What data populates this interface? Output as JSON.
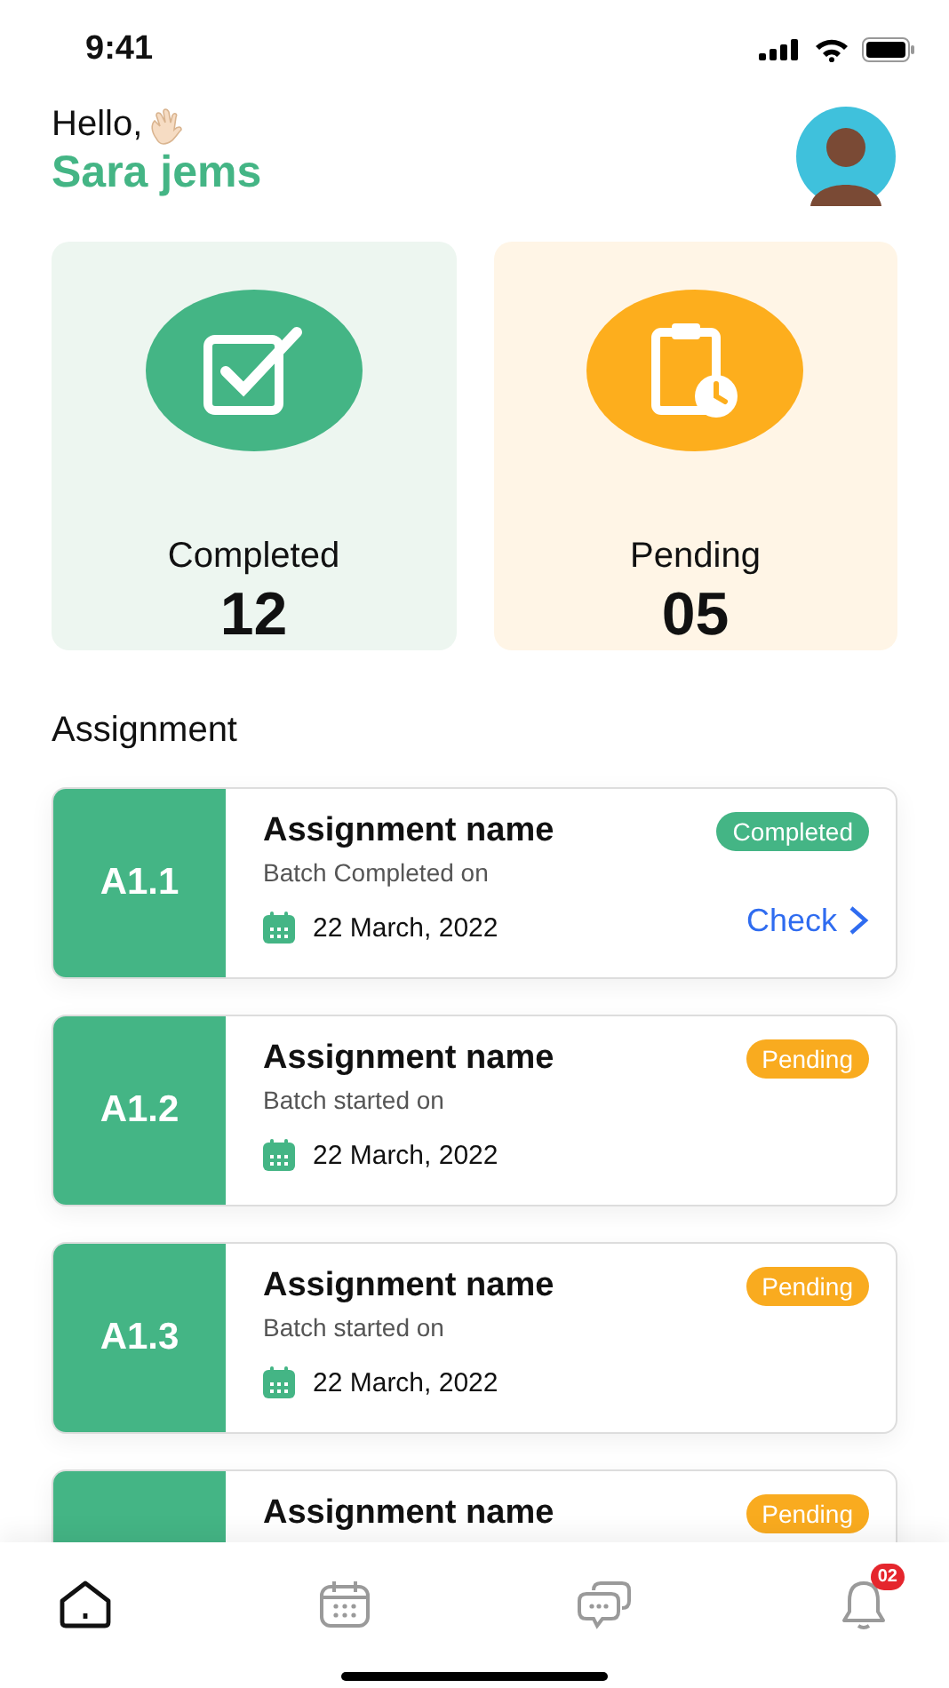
{
  "status_bar": {
    "time": "9:41"
  },
  "header": {
    "greeting": "Hello,",
    "name": "Sara jems"
  },
  "stats": [
    {
      "kind": "completed",
      "label": "Completed",
      "count": "12"
    },
    {
      "kind": "pending",
      "label": "Pending",
      "count": "05"
    }
  ],
  "section_title": "Assignment",
  "assignments": [
    {
      "code": "A1.1",
      "title": "Assignment name",
      "status": "Completed",
      "color": "#44b585",
      "subtitle": "Batch Completed on",
      "date": "22 March, 2022",
      "action": "Check"
    },
    {
      "code": "A1.2",
      "title": "Assignment name",
      "status": "Pending",
      "color": "#f9ab1f",
      "subtitle": "Batch started on",
      "date": "22 March, 2022"
    },
    {
      "code": "A1.3",
      "title": "Assignment name",
      "status": "Pending",
      "color": "#f9ab1f",
      "subtitle": "Batch started on",
      "date": "22 March, 2022"
    },
    {
      "title": "Assignment name",
      "status": "Pending",
      "color": "#f9ab1f"
    }
  ],
  "nav": [
    {
      "kind": "home",
      "selected": true
    },
    {
      "kind": "calendar",
      "selected": false
    },
    {
      "kind": "chat",
      "selected": false
    },
    {
      "kind": "bell",
      "selected": false,
      "badge": "02"
    }
  ]
}
